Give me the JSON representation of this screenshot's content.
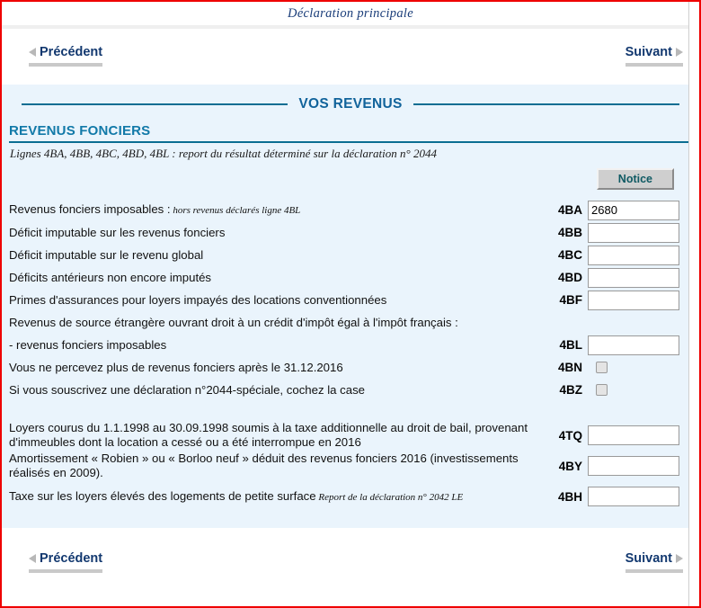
{
  "window": {
    "title": "Déclaration principale"
  },
  "nav": {
    "prev_label": "Précédent",
    "next_label": "Suivant"
  },
  "banner": {
    "title": "VOS REVENUS"
  },
  "section": {
    "title": "REVENUS FONCIERS",
    "subtitle": "Lignes 4BA, 4BB, 4BC, 4BD, 4BL : report du résultat déterminé sur la déclaration n° 2044",
    "notice_label": "Notice"
  },
  "rows": [
    {
      "label": "Revenus fonciers imposables :",
      "note": "hors revenus déclarés ligne 4BL",
      "code": "4BA",
      "type": "text",
      "value": "2680"
    },
    {
      "label": "Déficit imputable sur les revenus fonciers",
      "note": "",
      "code": "4BB",
      "type": "text",
      "value": ""
    },
    {
      "label": "Déficit imputable sur le revenu global",
      "note": "",
      "code": "4BC",
      "type": "text",
      "value": ""
    },
    {
      "label": "Déficits antérieurs non encore imputés",
      "note": "",
      "code": "4BD",
      "type": "text",
      "value": ""
    },
    {
      "label": "Primes d'assurances pour loyers impayés des locations conventionnées",
      "note": "",
      "code": "4BF",
      "type": "text",
      "value": ""
    },
    {
      "label": "Revenus de source étrangère ouvrant droit à un crédit d'impôt égal à l'impôt français :",
      "note": "",
      "code": "",
      "type": "none",
      "value": ""
    },
    {
      "label": "- revenus fonciers imposables",
      "note": "",
      "code": "4BL",
      "type": "text",
      "value": ""
    },
    {
      "label": "Vous ne percevez plus de revenus fonciers après le 31.12.2016",
      "note": "",
      "code": "4BN",
      "type": "checkbox",
      "value": ""
    },
    {
      "label": "Si vous souscrivez une déclaration n°2044-spéciale, cochez la case",
      "note": "",
      "code": "4BZ",
      "type": "checkbox",
      "value": ""
    }
  ],
  "rows2": [
    {
      "label": "Loyers courus du 1.1.1998 au 30.09.1998 soumis à la taxe additionnelle au droit de bail, provenant d'immeubles dont la location a cessé ou a été interrompue en 2016",
      "note": "",
      "code": "4TQ",
      "type": "text",
      "value": ""
    },
    {
      "label": "Amortissement « Robien » ou « Borloo neuf » déduit des revenus fonciers 2016 (investissements réalisés en 2009).",
      "note": "",
      "code": "4BY",
      "type": "text",
      "value": ""
    },
    {
      "label": "Taxe sur les loyers élevés des logements de petite surface",
      "note": "Report de la déclaration n° 2042 LE",
      "code": "4BH",
      "type": "text",
      "value": ""
    }
  ],
  "colors": {
    "accent_teal": "#0b6e92",
    "heading_blue": "#1179a8",
    "nav_navy": "#12386f",
    "panel_bg": "#eaf4fc",
    "page_border": "#ee0000"
  }
}
